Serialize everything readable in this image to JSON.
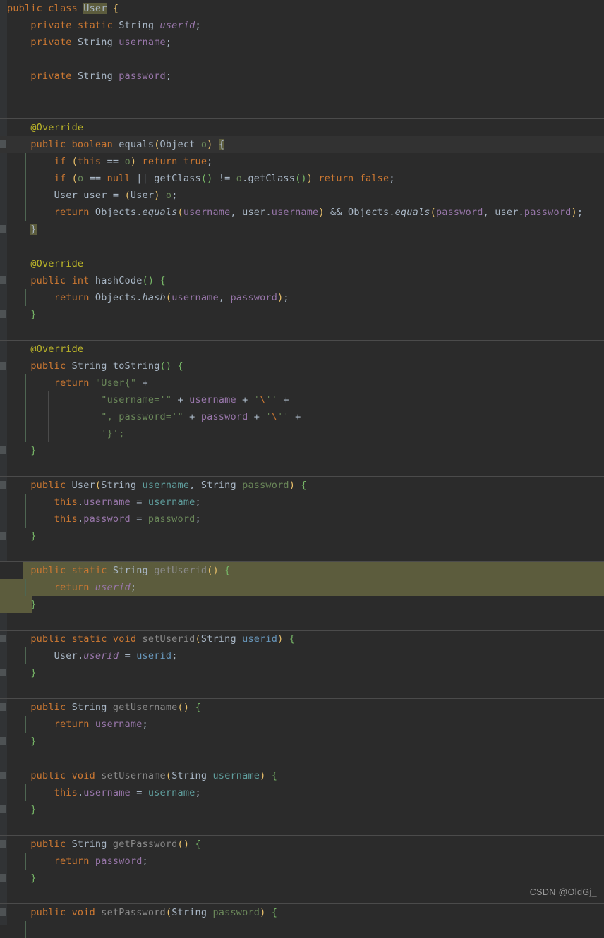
{
  "editor": {
    "language": "Java",
    "theme": "darcula",
    "background": "#2b2b2b",
    "gutter_background": "#313335",
    "caret_line_background": "#323232",
    "selection_background": "#5c5c3d",
    "separator_color": "#4b4b4b",
    "indent_guide_color": "#4e6652"
  },
  "watermark": {
    "text": "CSDN @OldGj_",
    "color": "#9b9b9b"
  },
  "code": {
    "class_declaration": {
      "modifier": "public",
      "keyword": "class",
      "name": "User",
      "brace": "{"
    },
    "fields": [
      {
        "modifiers": "private static",
        "type": "String",
        "name": "userid",
        "static": true
      },
      {
        "modifiers": "private",
        "type": "String",
        "name": "username",
        "static": false
      },
      {
        "modifiers": "private",
        "type": "String",
        "name": "password",
        "static": false
      }
    ],
    "methods": [
      {
        "annotation": "@Override",
        "signature": "public boolean equals(Object o) {",
        "name": "equals",
        "body": [
          "if (this == o) return true;",
          "if (o == null || getClass() != o.getClass()) return false;",
          "User user = (User) o;",
          "return Objects.equals(username, user.username) && Objects.equals(password, user.password);"
        ]
      },
      {
        "annotation": "@Override",
        "signature": "public int hashCode() {",
        "name": "hashCode",
        "body": [
          "return Objects.hash(username, password);"
        ]
      },
      {
        "annotation": "@Override",
        "signature": "public String toString() {",
        "name": "toString",
        "body": [
          "return \"User{\" +",
          "\"username='\" + username + '\\'' +",
          "\", password='\" + password + '\\'' +",
          "'}';"
        ]
      },
      {
        "annotation": "",
        "signature": "public User(String username, String password) {",
        "name": "User",
        "body": [
          "this.username = username;",
          "this.password = password;"
        ]
      },
      {
        "annotation": "",
        "signature": "public static String getUserid() {",
        "name": "getUserid",
        "selected": true,
        "body": [
          "return userid;"
        ]
      },
      {
        "annotation": "",
        "signature": "public static void setUserid(String userid) {",
        "name": "setUserid",
        "body": [
          "User.userid = userid;"
        ]
      },
      {
        "annotation": "",
        "signature": "public String getUsername() {",
        "name": "getUsername",
        "body": [
          "return username;"
        ]
      },
      {
        "annotation": "",
        "signature": "public void setUsername(String username) {",
        "name": "setUsername",
        "body": [
          "this.username = username;"
        ]
      },
      {
        "annotation": "",
        "signature": "public String getPassword() {",
        "name": "getPassword",
        "body": [
          "return password;"
        ]
      },
      {
        "annotation": "",
        "signature": "public void setPassword(String password) {",
        "name": "setPassword",
        "body": []
      }
    ],
    "tokens": {
      "public": "public",
      "private": "private",
      "static": "static",
      "class": "class",
      "boolean": "boolean",
      "int": "int",
      "void": "void",
      "String": "String",
      "Object": "Object",
      "return": "return",
      "if": "if",
      "this": "this",
      "null": "null",
      "true": "true",
      "false": "false",
      "Objects": "Objects",
      "equals": "equals",
      "hash": "hash",
      "getClass": "getClass",
      "User": "User",
      "user": "user",
      "o": "o",
      "userid": "userid",
      "username": "username",
      "password": "password",
      "override": "@Override",
      "open_brace": "{",
      "close_brace": "}",
      "semicolon": ";",
      "plus": "+",
      "assign": "=",
      "eq": "==",
      "neq": "!=",
      "and": "&&",
      "or": "||",
      "dot": ".",
      "comma": ",",
      "lparen": "(",
      "rparen": ")",
      "str_user_open": "\"User{\"",
      "str_username": "\"username='\"",
      "str_password": "\", password='\"",
      "char_quote": "'\\''",
      "str_close": "'}';"
    }
  }
}
